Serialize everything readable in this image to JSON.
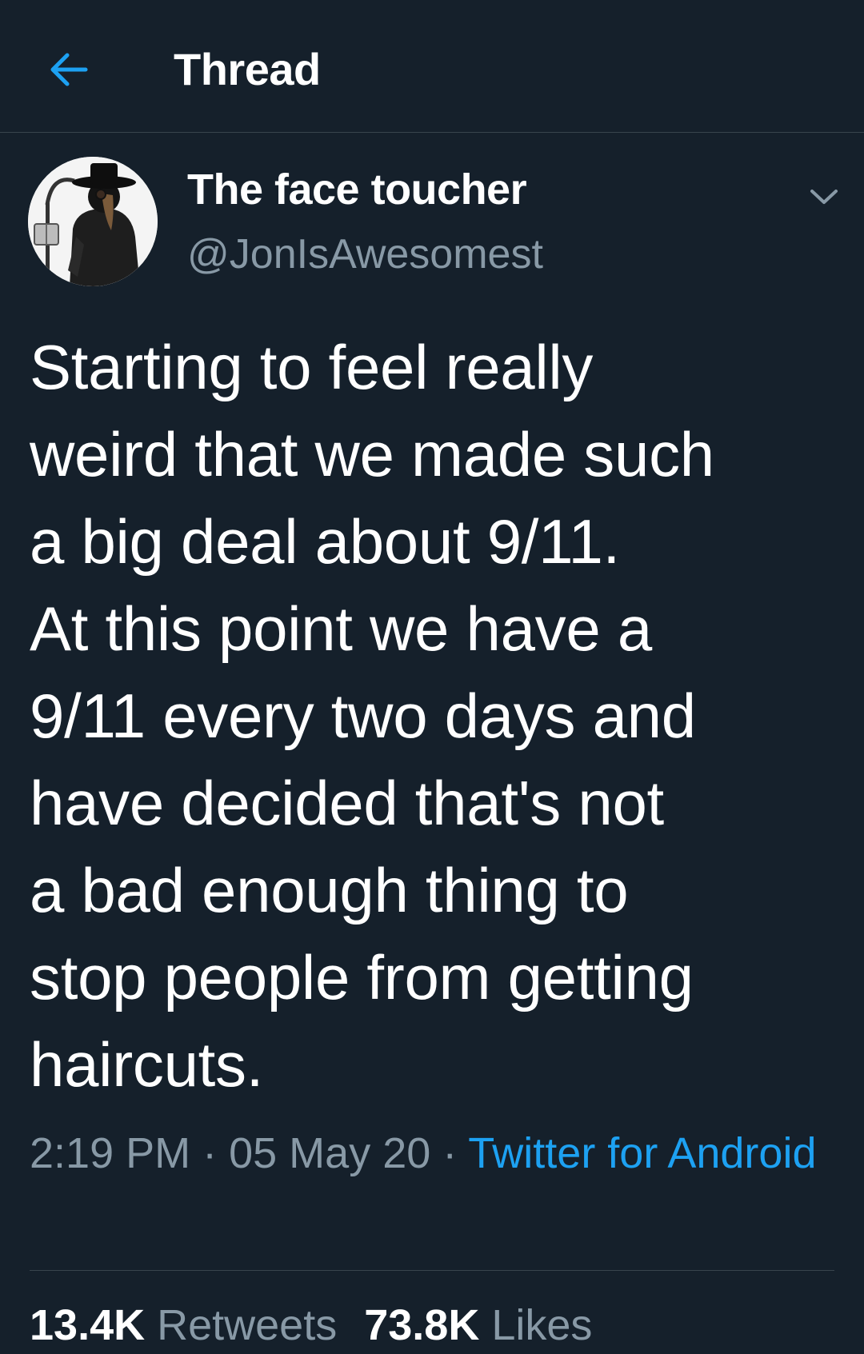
{
  "colors": {
    "background": "#15202b",
    "accent": "#1da1f2",
    "secondary_text": "#8899a6",
    "divider": "#38444d"
  },
  "header": {
    "back_icon": "arrow-left-icon",
    "title": "Thread"
  },
  "tweet": {
    "author": {
      "display_name": "The face toucher",
      "handle": "@JonIsAwesomest",
      "avatar_icon": "avatar-plague-doctor"
    },
    "menu_icon": "chevron-down-icon",
    "text": "Starting to feel really\nweird that we made such\na big deal about 9/11.\nAt this point we have a\n9/11 every two days and\nhave decided that's not\na bad enough thing to\nstop people from getting\nhaircuts.",
    "time": "2:19 PM",
    "separator": " · ",
    "date": "05 May 20",
    "source": "Twitter for Android",
    "stats": {
      "retweets_count": "13.4K",
      "retweets_label": " Retweets",
      "likes_count": "73.8K",
      "likes_label": " Likes"
    }
  }
}
